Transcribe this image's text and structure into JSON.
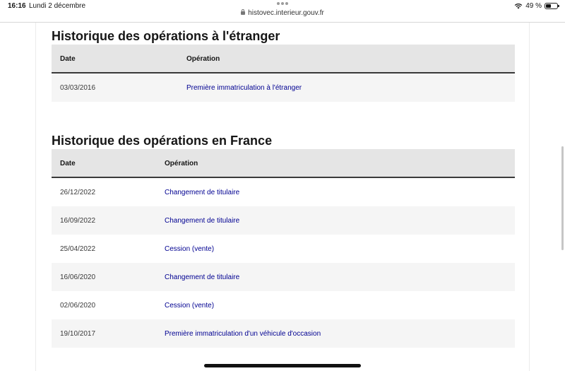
{
  "status_bar": {
    "time": "16:16",
    "date": "Lundi 2 décembre",
    "url": "histovec.interieur.gouv.fr",
    "battery": "49 %"
  },
  "foreign_section": {
    "title": "Historique des opérations à l'étranger",
    "columns": {
      "date": "Date",
      "operation": "Opération"
    },
    "rows": [
      {
        "date": "03/03/2016",
        "operation": "Première immatriculation à l'étranger"
      }
    ]
  },
  "france_section": {
    "title": "Historique des opérations en France",
    "columns": {
      "date": "Date",
      "operation": "Opération"
    },
    "rows": [
      {
        "date": "26/12/2022",
        "operation": "Changement de titulaire"
      },
      {
        "date": "16/09/2022",
        "operation": "Changement de titulaire"
      },
      {
        "date": "25/04/2022",
        "operation": "Cession (vente)"
      },
      {
        "date": "16/06/2020",
        "operation": "Changement de titulaire"
      },
      {
        "date": "02/06/2020",
        "operation": "Cession (vente)"
      },
      {
        "date": "19/10/2017",
        "operation": "Première immatriculation d'un véhicule d'occasion"
      }
    ]
  },
  "colors": {
    "link": "#000091",
    "header_bg": "#e5e5e5",
    "stripe_bg": "#f5f5f5"
  }
}
